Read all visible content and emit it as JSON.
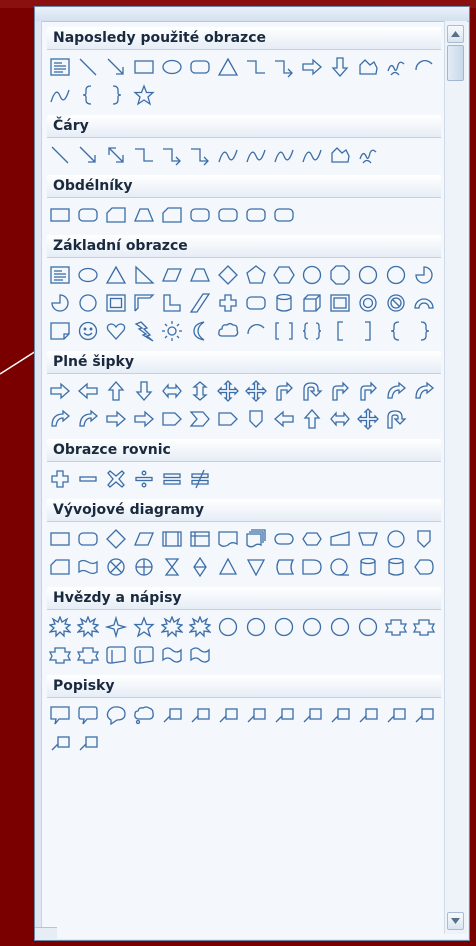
{
  "categories": [
    {
      "id": "recent",
      "title": "Naposledy použité obrazce",
      "shapes": [
        "textbox-icon",
        "line-icon",
        "arrow-line-icon",
        "rectangle-icon",
        "oval-icon",
        "rounded-rectangle-icon",
        "triangle-icon",
        "elbow-connector-icon",
        "elbow-arrow-connector-icon",
        "right-arrow-icon",
        "down-arrow-icon",
        "freeform-icon",
        "scribble-icon",
        "arc-icon",
        "curve-icon",
        "left-brace-icon",
        "right-brace-icon",
        "star-icon"
      ]
    },
    {
      "id": "lines",
      "title": "Čáry",
      "shapes": [
        "line-icon",
        "arrow-line-icon",
        "double-arrow-line-icon",
        "elbow-connector-icon",
        "elbow-arrow-connector-icon",
        "elbow-double-arrow-icon",
        "curved-connector-icon",
        "curved-arrow-connector-icon",
        "curved-double-arrow-icon",
        "curve-icon",
        "freeform-icon",
        "scribble-icon"
      ]
    },
    {
      "id": "rectangles",
      "title": "Obdélníky",
      "shapes": [
        "rectangle-icon",
        "rounded-rectangle-icon",
        "snip-single-corner-icon",
        "snip-same-side-icon",
        "snip-diagonal-icon",
        "snip-round-icon",
        "round-single-corner-icon",
        "round-same-side-icon",
        "round-diagonal-icon"
      ]
    },
    {
      "id": "basic",
      "title": "Základní obrazce",
      "shapes": [
        "textbox-icon",
        "oval-icon",
        "triangle-icon",
        "right-triangle-icon",
        "parallelogram-icon",
        "trapezoid-icon",
        "diamond-icon",
        "pentagon-icon",
        "hexagon-icon",
        "heptagon-icon",
        "octagon-icon",
        "decagon-icon",
        "dodecagon-icon",
        "pie-icon",
        "chord-icon",
        "teardrop-icon",
        "frame-icon",
        "half-frame-icon",
        "l-shape-icon",
        "diagonal-stripe-icon",
        "cross-icon",
        "plaque-icon",
        "can-icon",
        "cube-icon",
        "bevel-icon",
        "donut-icon",
        "no-symbol-icon",
        "block-arc-icon",
        "folded-corner-icon",
        "smiley-icon",
        "heart-icon",
        "lightning-icon",
        "sun-icon",
        "moon-icon",
        "cloud-icon",
        "arc-icon",
        "double-bracket-icon",
        "double-brace-icon",
        "left-bracket-icon",
        "right-bracket-icon",
        "left-brace-icon",
        "right-brace-icon"
      ]
    },
    {
      "id": "block-arrows",
      "title": "Plné šipky",
      "shapes": [
        "right-arrow-icon",
        "left-arrow-icon",
        "up-arrow-icon",
        "down-arrow-icon",
        "left-right-arrow-icon",
        "up-down-arrow-icon",
        "quad-arrow-icon",
        "left-right-up-arrow-icon",
        "bent-arrow-icon",
        "u-turn-arrow-icon",
        "left-up-arrow-icon",
        "bent-up-arrow-icon",
        "curved-right-arrow-icon",
        "curved-left-arrow-icon",
        "curved-up-arrow-icon",
        "curved-down-arrow-icon",
        "striped-right-arrow-icon",
        "notched-right-arrow-icon",
        "pentagon-arrow-icon",
        "chevron-icon",
        "right-arrow-callout-icon",
        "down-arrow-callout-icon",
        "left-arrow-callout-icon",
        "up-arrow-callout-icon",
        "left-right-arrow-callout-icon",
        "quad-arrow-callout-icon",
        "circular-arrow-icon"
      ]
    },
    {
      "id": "equation",
      "title": "Obrazce rovnic",
      "shapes": [
        "plus-icon",
        "minus-icon",
        "multiply-icon",
        "divide-icon",
        "equal-icon",
        "not-equal-icon"
      ]
    },
    {
      "id": "flowchart",
      "title": "Vývojové diagramy",
      "shapes": [
        "process-icon",
        "alternate-process-icon",
        "decision-icon",
        "data-icon",
        "predefined-process-icon",
        "internal-storage-icon",
        "document-icon",
        "multidocument-icon",
        "terminator-icon",
        "preparation-icon",
        "manual-input-icon",
        "manual-operation-icon",
        "connector-icon",
        "off-page-connector-icon",
        "card-icon",
        "punched-tape-icon",
        "summing-junction-icon",
        "or-icon",
        "collate-icon",
        "sort-icon",
        "extract-icon",
        "merge-icon",
        "stored-data-icon",
        "delay-icon",
        "sequential-storage-icon",
        "magnetic-disk-icon",
        "direct-access-storage-icon",
        "display-icon"
      ]
    },
    {
      "id": "stars",
      "title": "Hvězdy a nápisy",
      "shapes": [
        "explosion-1-icon",
        "explosion-2-icon",
        "star-4-icon",
        "star-5-icon",
        "star-6-icon",
        "star-7-icon",
        "star-8-icon",
        "star-10-icon",
        "star-12-icon",
        "star-16-icon",
        "star-24-icon",
        "star-32-icon",
        "up-ribbon-icon",
        "down-ribbon-icon",
        "curved-up-ribbon-icon",
        "curved-down-ribbon-icon",
        "vertical-scroll-icon",
        "horizontal-scroll-icon",
        "wave-icon",
        "double-wave-icon"
      ]
    },
    {
      "id": "callouts",
      "title": "Popisky",
      "shapes": [
        "rectangular-callout-icon",
        "rounded-rectangular-callout-icon",
        "oval-callout-icon",
        "cloud-callout-icon",
        "line-callout-1-icon",
        "line-callout-2-icon",
        "line-callout-3-icon",
        "line-callout-4-icon",
        "line-callout-1-accent-icon",
        "line-callout-2-accent-icon",
        "line-callout-3-accent-icon",
        "line-callout-4-accent-icon",
        "line-callout-1-noborder-icon",
        "line-callout-2-bordered-icon",
        "line-callout-3-bordered-icon",
        "line-callout-4-bordered-icon"
      ]
    }
  ],
  "colors": {
    "background": "#7a0000",
    "panel": "#f4f7fb",
    "shape_stroke": "#3b6ea8",
    "header_text": "#1a2a3e"
  }
}
